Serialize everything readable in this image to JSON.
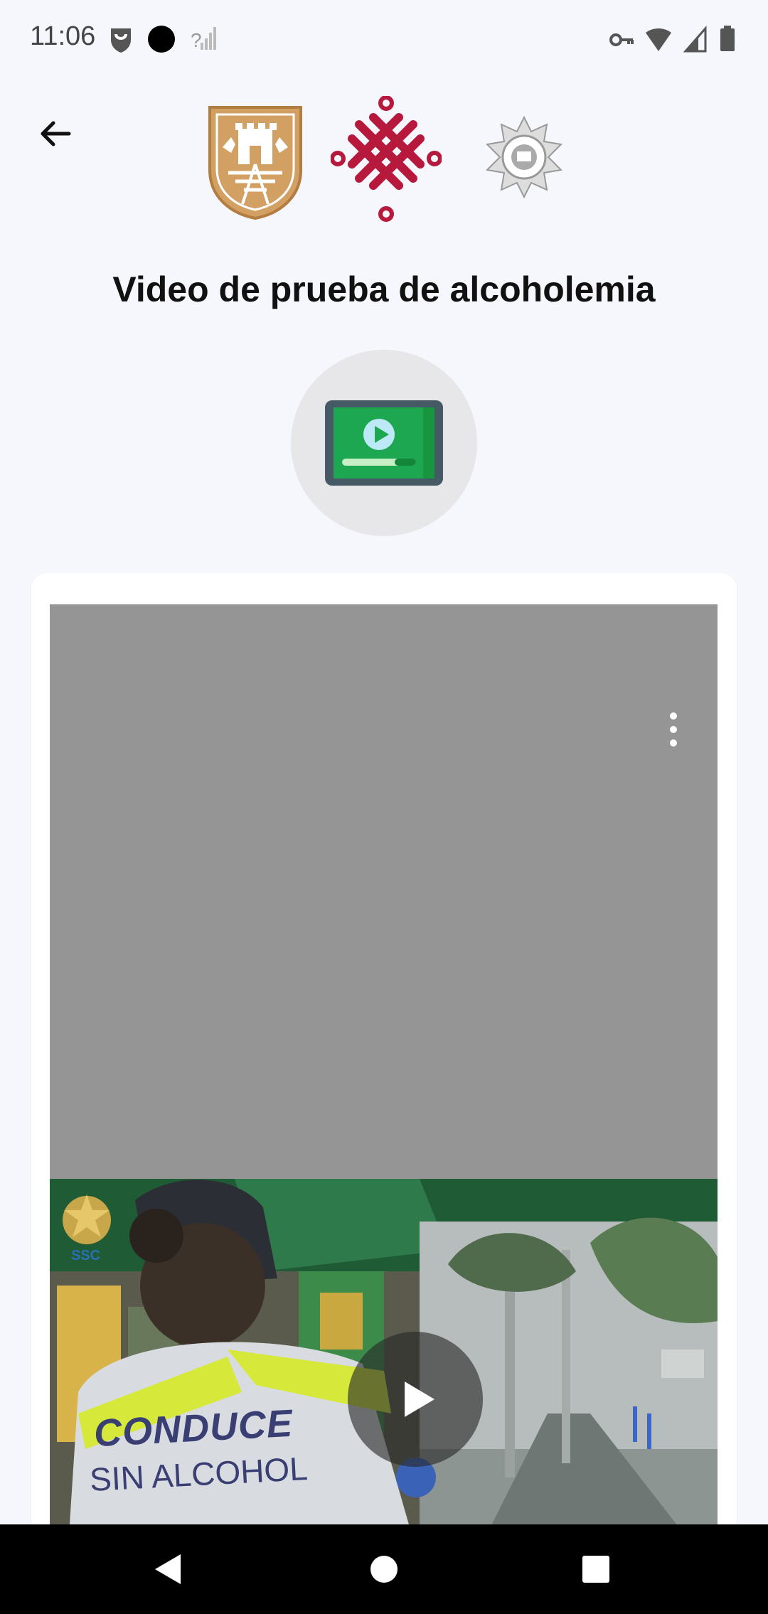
{
  "status_bar": {
    "time": "11:06",
    "signal_label": "?"
  },
  "header": {
    "title": "Video de prueba de alcoholemia"
  },
  "video": {
    "vest_line1": "CONDUCE",
    "vest_line2": "SIN ALCOHOL",
    "watermark": "SSC"
  },
  "colors": {
    "background": "#f6f7fc",
    "cdmx_red": "#b7193d",
    "shield_gold": "#c9955b",
    "player_gray": "#959595",
    "badge_green": "#1ea751"
  }
}
